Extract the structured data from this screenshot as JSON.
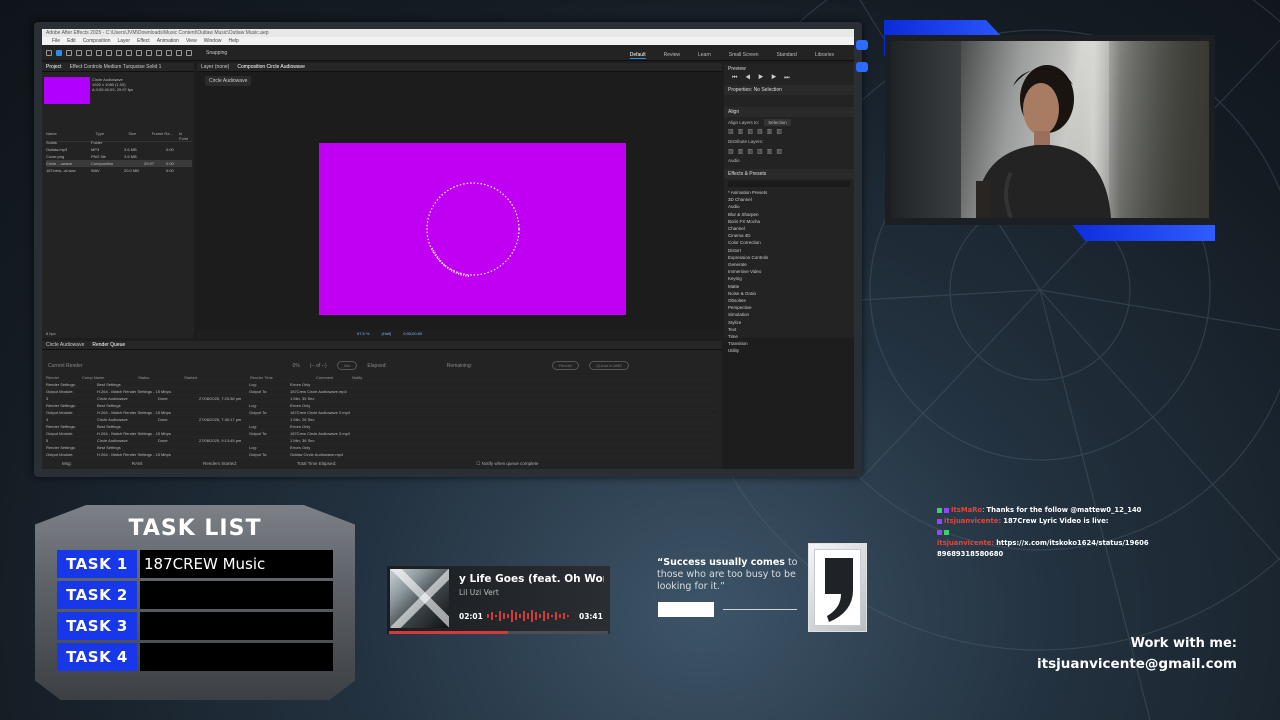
{
  "ae": {
    "title": "Adobe After Effects 2025 - C:\\Users\\JVM\\Downloads\\Music Content\\Outlaw Music\\Outlaw Music.aep",
    "menu": [
      "File",
      "Edit",
      "Composition",
      "Layer",
      "Effect",
      "Animation",
      "View",
      "Window",
      "Help"
    ],
    "snapping": "Snapping",
    "workspaces": [
      "Default",
      "Review",
      "Learn",
      "Small Screen",
      "Standard",
      "Libraries"
    ],
    "project_tab": "Project",
    "effect_controls_tab": "Effect Controls Medium Turquoise Solid 1",
    "project_item_name": "Circle Audiowave",
    "project_item_info": [
      "1920 x 1080 (1.00)",
      "Δ 0;00;40;09, 29.97 fps"
    ],
    "project_columns": [
      "Name",
      "Type",
      "Size",
      "Frame Ra...",
      "In Point"
    ],
    "project_rows": [
      {
        "name": "Solids",
        "type": "Folder",
        "size": "",
        "fps": "",
        "in": ""
      },
      {
        "name": "Outlaw.mp3",
        "type": "MP3",
        "size": "3.6 MB",
        "fps": "",
        "in": "0:00"
      },
      {
        "name": "Cover.png",
        "type": "PNG file",
        "size": "3.6 MB",
        "fps": "",
        "in": ""
      },
      {
        "name": "Circle ...owave",
        "type": "Composition",
        "size": "",
        "fps": "29.97",
        "in": "0:00"
      },
      {
        "name": "187crew...al.wav",
        "type": "WAV",
        "size": "20.0 MB",
        "fps": "",
        "in": "0:00"
      }
    ],
    "layer_tab": "Layer (none)",
    "comp_tab": "Composition Circle Audiowave",
    "comp_chip": "Circle Audiowave",
    "viewer_zoom": "57.5 %",
    "viewer_res": "(Half)",
    "viewer_time": "0;00;00;00",
    "bpc": "8 bpc",
    "preview_title": "Preview",
    "properties_title": "Properties: No Selection",
    "align_title": "Align",
    "align_to_label": "Align Layers to:",
    "align_to_value": "Selection",
    "distribute_label": "Distribute Layers:",
    "audio_label": "Audio",
    "effects_title": "Effects & Presets",
    "effects": [
      "* Animation Presets",
      "3D Channel",
      "Audio",
      "Blur & Sharpen",
      "Boris FX Mocha",
      "Channel",
      "Cinema 4D",
      "Color Correction",
      "Distort",
      "Expression Controls",
      "Generate",
      "Immersive Video",
      "Keying",
      "Matte",
      "Noise & Grain",
      "Obsolete",
      "Perspective",
      "Simulation",
      "Stylize",
      "Text",
      "Time",
      "Transition",
      "Utility"
    ],
    "render_tabs": [
      "Circle Audiowave",
      "Render Queue"
    ],
    "current_render": "Current Render",
    "render_pct": "0%",
    "render_of": "(-- of --)",
    "info_btn": "Info",
    "elapsed": "Elapsed:",
    "remaining": "Remaining:",
    "render_btn": "Render",
    "queue_btn": "Queue in AME",
    "rq_columns": [
      "Render",
      "Comp Name",
      "Status",
      "Started",
      "Render Time",
      "Comment",
      "Notify"
    ],
    "rq_rows": [
      [
        "Render Settings:",
        "Best Settings",
        "",
        "Log:",
        "Errors Only"
      ],
      [
        "Output Module:",
        "H.264 - Match Render Settings - 15 Mbps",
        "",
        "Output To:",
        "187Crew Circle Audiowave.mp4"
      ],
      [
        "3",
        "Circle Audiowave",
        "Done",
        "27/08/2025, 7:23:36 pm",
        "1 Min, 35 Sec"
      ],
      [
        "Render Settings:",
        "Best Settings",
        "",
        "Log:",
        "Errors Only"
      ],
      [
        "Output Module:",
        "H.264 - Match Render Settings - 15 Mbps",
        "",
        "Output To:",
        "187Crew Circle Audiowave 2.mp4"
      ],
      [
        "4",
        "Circle Audiowave",
        "Done",
        "27/08/2025, 7:30:17 pm",
        "1 Min, 26 Sec"
      ],
      [
        "Render Settings:",
        "Best Settings",
        "",
        "Log:",
        "Errors Only"
      ],
      [
        "Output Module:",
        "H.264 - Match Render Settings - 15 Mbps",
        "",
        "Output To:",
        "187Crew Circle Audiowave 3.mp4"
      ],
      [
        "5",
        "Circle Audiowave",
        "Done",
        "27/08/2025, 9:13:45 pm",
        "1 Min, 36 Sec"
      ],
      [
        "Render Settings:",
        "Best Settings",
        "",
        "Log:",
        "Errors Only"
      ],
      [
        "Output Module:",
        "H.264 - Match Render Settings - 15 Mbps",
        "",
        "Output To:",
        "Outlaw Circle Audiowave.mp4"
      ]
    ],
    "rq_bottom": [
      "Msg:",
      "RAM:",
      "Renders Started:",
      "Total Time Elapsed:"
    ],
    "notify_label": "Notify when queue complete",
    "canvas_color": "#c000f2"
  },
  "tasks": {
    "title": "TASK LIST",
    "items": [
      {
        "label": "TASK 1",
        "value": "187CREW Music"
      },
      {
        "label": "TASK 2",
        "value": ""
      },
      {
        "label": "TASK 3",
        "value": ""
      },
      {
        "label": "TASK 4",
        "value": ""
      }
    ],
    "accent": "#1737e8"
  },
  "player": {
    "song": "y Life Goes (feat. Oh Wonder)",
    "artist": "Lil Uzi Vert",
    "elapsed": "02:01",
    "total": "03:41",
    "progress": 0.545,
    "accent": "#d33a3a"
  },
  "quote": {
    "bold": "“Success usually comes",
    "rest": " to those who are too busy to be looking for it.”"
  },
  "chat": [
    {
      "name": "ItsMaRo",
      "msg": "Thanks for the follow @mattew0_12_140"
    },
    {
      "name": "itsjuanvicente:",
      "msg": "187Crew Lyric Video is live:"
    },
    {
      "name": "itsjuanvicente:",
      "msg": "https://x.com/itskoko1624/status/1960689689318580680"
    }
  ],
  "contact": {
    "heading": "Work with me:",
    "email": "itsjuanvicente@gmail.com"
  }
}
